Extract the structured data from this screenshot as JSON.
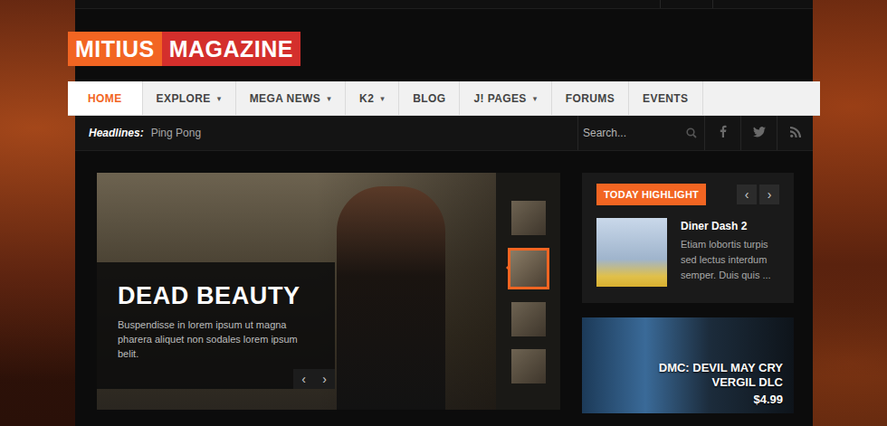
{
  "logo": {
    "part1": "MITIUS",
    "part2": "MAGAZINE"
  },
  "nav": {
    "caret": "▾",
    "items": [
      {
        "label": "HOME",
        "has_menu": false,
        "selected": true
      },
      {
        "label": "EXPLORE",
        "has_menu": true,
        "selected": false
      },
      {
        "label": "MEGA NEWS",
        "has_menu": true,
        "selected": false
      },
      {
        "label": "K2",
        "has_menu": true,
        "selected": false
      },
      {
        "label": "BLOG",
        "has_menu": false,
        "selected": false
      },
      {
        "label": "J! PAGES",
        "has_menu": true,
        "selected": false
      },
      {
        "label": "FORUMS",
        "has_menu": false,
        "selected": false
      },
      {
        "label": "EVENTS",
        "has_menu": false,
        "selected": false
      }
    ]
  },
  "headlines": {
    "label": "Headlines:",
    "text": "Ping Pong"
  },
  "search": {
    "placeholder": "Search..."
  },
  "slider": {
    "title": "DEAD BEAUTY",
    "text": "Buspendisse in lorem ipsum ut magna pharera aliquet non sodales lorem ipsum belit.",
    "prev": "‹",
    "next": "›",
    "thumbs": [
      {
        "selected": false
      },
      {
        "selected": true
      },
      {
        "selected": false
      },
      {
        "selected": false
      }
    ]
  },
  "highlight": {
    "label": "TODAY HIGHLIGHT",
    "prev": "‹",
    "next": "›",
    "items": [
      {
        "title": "Diner Dash 2",
        "text": "Etiam lobortis turpis sed lectus interdum semper. Duis quis ..."
      }
    ]
  },
  "ad": {
    "lines": [
      "DMC: DEVIL MAY CRY",
      "VERGIL DLC"
    ],
    "price": "$4.99"
  }
}
